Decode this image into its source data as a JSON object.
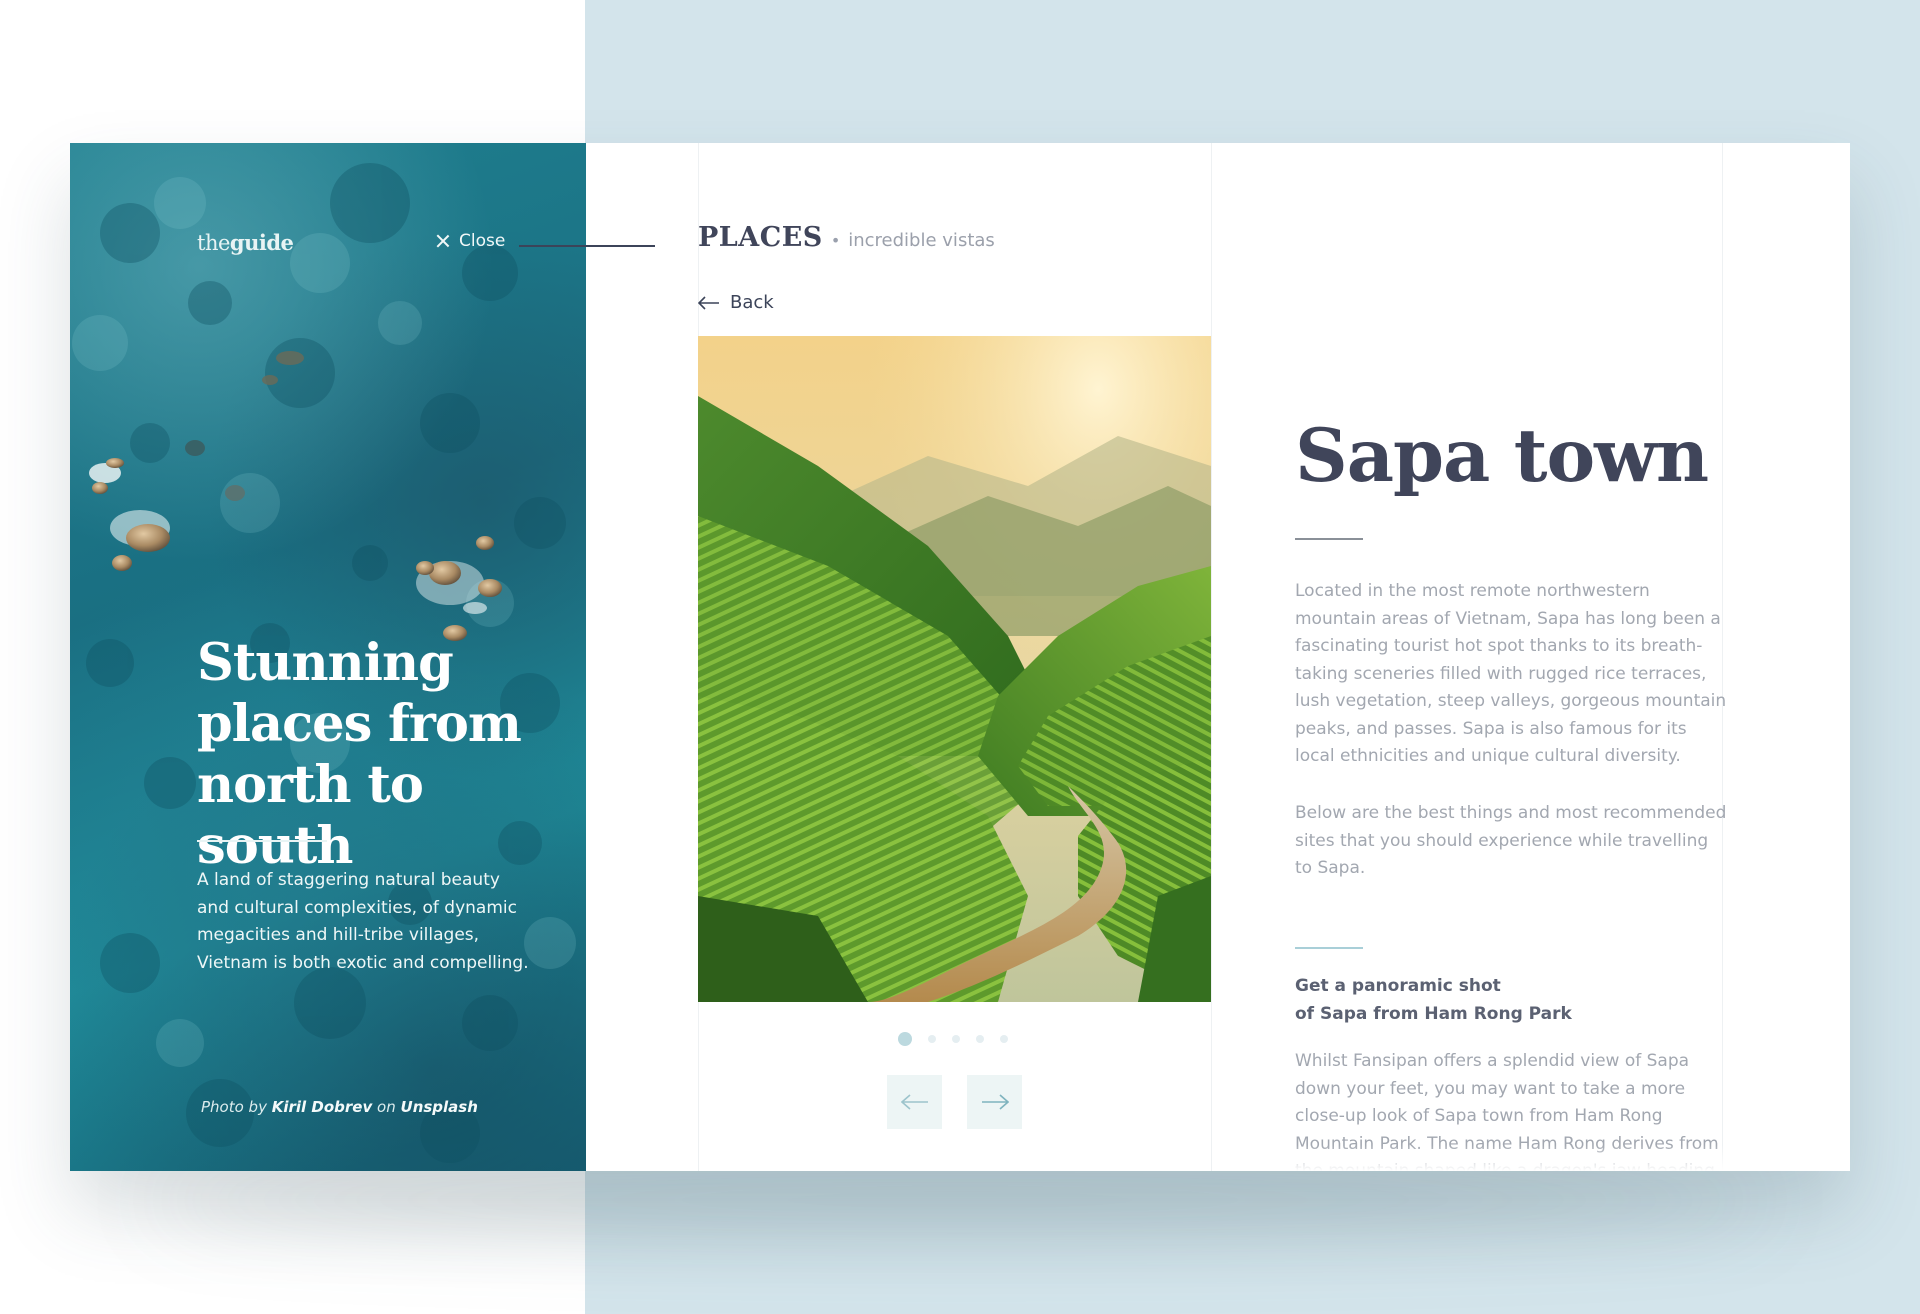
{
  "brand": {
    "logo_light": "the",
    "logo_bold": "guide"
  },
  "hero": {
    "close_label": "Close",
    "title_line1": "Stunning",
    "title_line2": "places from",
    "title_line3": "north to south",
    "description": "A land of staggering natural beauty and cultural complexities, of dynamic megacities and hill-tribe villages, Vietnam is both exotic and compelling.",
    "credit_prefix": "Photo by",
    "credit_author": "Kiril Dobrev",
    "credit_on": "on",
    "credit_site": "Unsplash"
  },
  "section": {
    "label": "PLACES",
    "separator": "•",
    "tagline": "incredible vistas"
  },
  "nav": {
    "back_label": "Back"
  },
  "gallery": {
    "slides": 5,
    "active_index": 0
  },
  "article": {
    "title": "Sapa town",
    "paragraph1": "Located in the most remote northwestern mountain areas of Vietnam, Sapa has long been a fascinating tourist hot spot thanks to its breath-taking sceneries filled with rugged rice terraces, lush vegetation, steep valleys, gorgeous mountain peaks, and passes. Sapa is also famous for its local ethnicities and unique cultural diversity.",
    "paragraph2": "Below are the best things and most recommended sites that you should experience while travelling to Sapa.",
    "subheading_line1": "Get a panoramic shot",
    "subheading_line2": "of Sapa from Ham Rong Park",
    "paragraph3": "Whilst Fansipan offers a splendid view of Sapa down your feet, you may want to take a more close-up look of Sapa town from Ham Rong Mountain Park. The name Ham Rong derives from the mountain shaped like a dragon's jaw heading"
  },
  "colors": {
    "background_right": "#d3e4eb",
    "heading": "#40455a",
    "body_text": "#a2a7b0",
    "accent": "#a9cfd8",
    "ocean": "#1f7f8f"
  },
  "icons": {
    "close": "close-icon",
    "back": "arrow-left-icon",
    "prev": "arrow-left-icon",
    "next": "arrow-right-icon"
  }
}
